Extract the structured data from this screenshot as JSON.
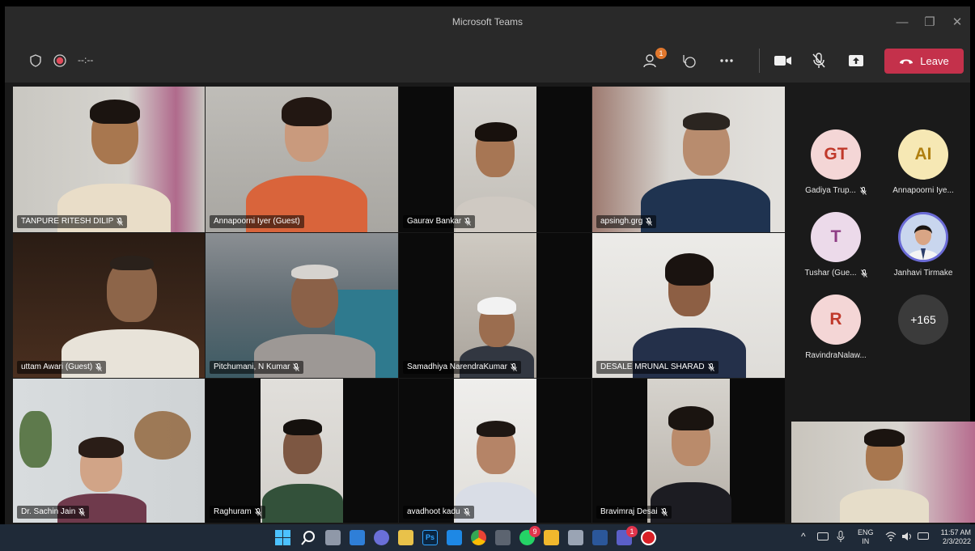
{
  "window": {
    "title": "Microsoft Teams",
    "minimize_glyph": "—",
    "maximize_glyph": "❐",
    "close_glyph": "✕"
  },
  "controls": {
    "timer": "--:--",
    "participants_badge": "1",
    "leave_label": "Leave",
    "icons": [
      "shield-icon",
      "record-icon",
      "participants-icon",
      "reactions-icon",
      "more-options-icon",
      "camera-icon",
      "mic-muted-icon",
      "share-icon",
      "phone-icon"
    ]
  },
  "tiles": [
    {
      "name": "TANPURE RITESH DILIP"
    },
    {
      "name": "Annapoorni Iyer (Guest)"
    },
    {
      "name": "Gaurav Bankar"
    },
    {
      "name": "apsingh.grg"
    },
    {
      "name": "uttam Awari (Guest)"
    },
    {
      "name": "Pitchumani, N Kumar"
    },
    {
      "name": "Samadhiya NarendraKumar"
    },
    {
      "name": "DESALE MRUNAL SHARAD"
    },
    {
      "name": "Dr. Sachin Jain"
    },
    {
      "name": "Raghuram"
    },
    {
      "name": "avadhoot kadu"
    },
    {
      "name": "Bravimraj Desai"
    }
  ],
  "roster": [
    {
      "initials": "GT",
      "name": "Gadiya Trup...",
      "color": "#f4d6d6",
      "text_color": "#c0392b"
    },
    {
      "initials": "AI",
      "name": "Annapoorni Iye...",
      "color": "#f6e8b4",
      "text_color": "#b07f0f"
    },
    {
      "initials": "T",
      "name": "Tushar (Gue...",
      "color": "#ecdaea",
      "text_color": "#8e3d84"
    },
    {
      "initials": "",
      "name": "Janhavi Tirmake",
      "color": "#c9d6ee",
      "text_color": "#333"
    },
    {
      "initials": "R",
      "name": "RavindraNalaw...",
      "color": "#f4d6d6",
      "text_color": "#c0392b"
    },
    {
      "initials": "+165",
      "name": "",
      "color": "#3b3b3b",
      "text_color": "#ffffff"
    }
  ],
  "taskbar": {
    "icons": [
      "windows-start-icon",
      "search-icon",
      "task-view-icon",
      "widgets-icon",
      "chat-icon",
      "file-explorer-icon",
      "photoshop-icon",
      "mail-icon",
      "chrome-icon",
      "calculator-icon",
      "whatsapp-icon",
      "folder-icon",
      "projector-icon",
      "word-icon",
      "teams-icon",
      "recorder-icon"
    ],
    "photoshop_label": "Ps",
    "whatsapp_badge": "9",
    "teams_badge": "1",
    "tray": {
      "lang": "ENG",
      "region": "IN",
      "time": "11:57 AM",
      "date": "2/3/2022",
      "chevron": "^"
    }
  }
}
